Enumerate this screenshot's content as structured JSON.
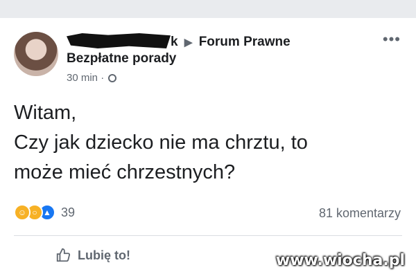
{
  "post": {
    "author_suffix": "k",
    "group": "Forum Prawne",
    "subline": "Bezpłatne porady",
    "time": "30 min",
    "separator": "·",
    "more": "•••",
    "lines": [
      "Witam,",
      "Czy jak dziecko nie ma chrztu, to",
      "może mieć chrzestnych?"
    ]
  },
  "reactions": {
    "count": "39",
    "comments": "81 komentarzy"
  },
  "actions": {
    "like_label": "Lubię to!"
  },
  "watermark": "www.wiocha.pl"
}
